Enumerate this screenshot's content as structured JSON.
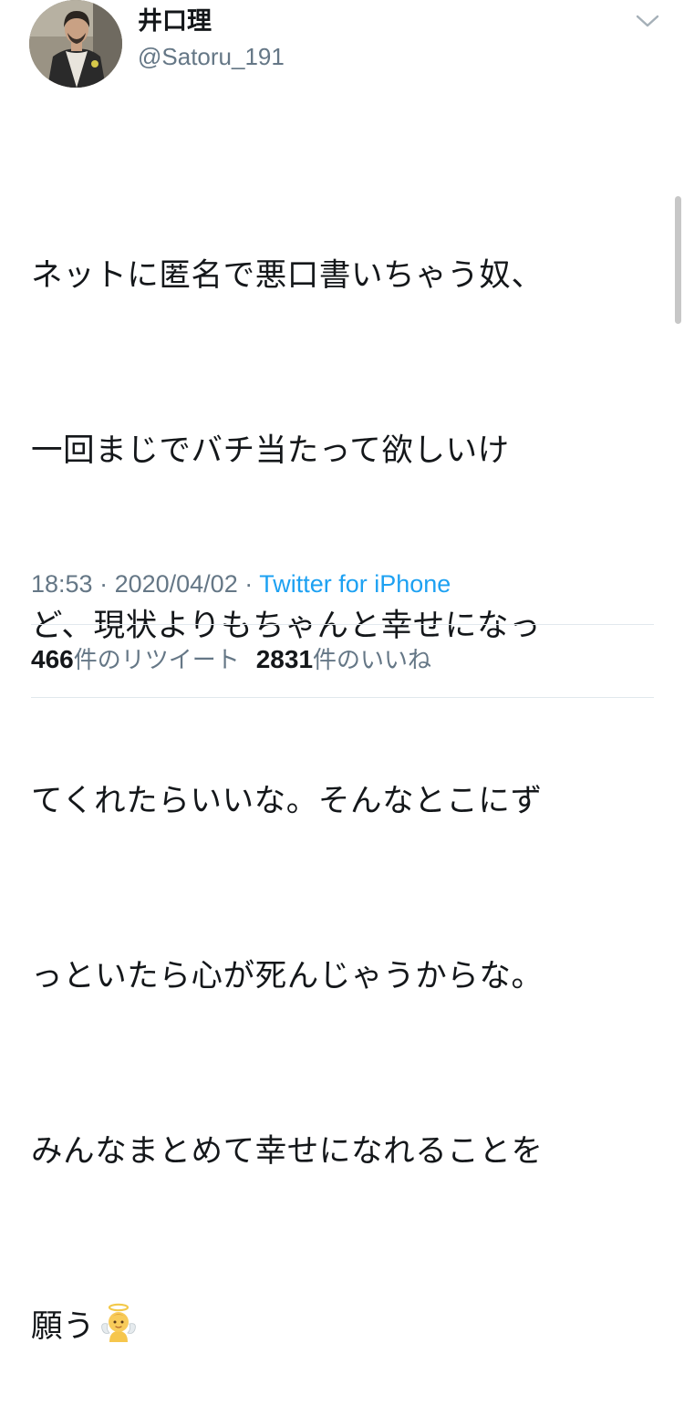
{
  "user": {
    "display_name": "井口理",
    "handle": "@Satoru_191",
    "avatar_icon": "user-avatar-photo"
  },
  "tweet": {
    "lines": [
      "ネットに匿名で悪口書いちゃう奴、",
      "一回まじでバチ当たって欲しいけ",
      "ど、現状よりもちゃんと幸せになっ",
      "てくれたらいいな。そんなとこにず",
      "っといたら心が死んじゃうからな。",
      "みんなまとめて幸せになれることを",
      "願う"
    ],
    "emoji": "angel-baby-emoji"
  },
  "meta": {
    "time": "18:53",
    "separator": " · ",
    "date": "2020/04/02",
    "separator2": " · ",
    "source": "Twitter for iPhone"
  },
  "stats": {
    "retweets_count": "466",
    "retweets_label": "件のリツイート",
    "likes_count": "2831",
    "likes_label": "件のいいね"
  },
  "colors": {
    "text": "#14171a",
    "secondary": "#657786",
    "link": "#1da1f2",
    "divider": "#e1e8ed"
  },
  "icons": {
    "menu": "chevron-down-icon"
  }
}
